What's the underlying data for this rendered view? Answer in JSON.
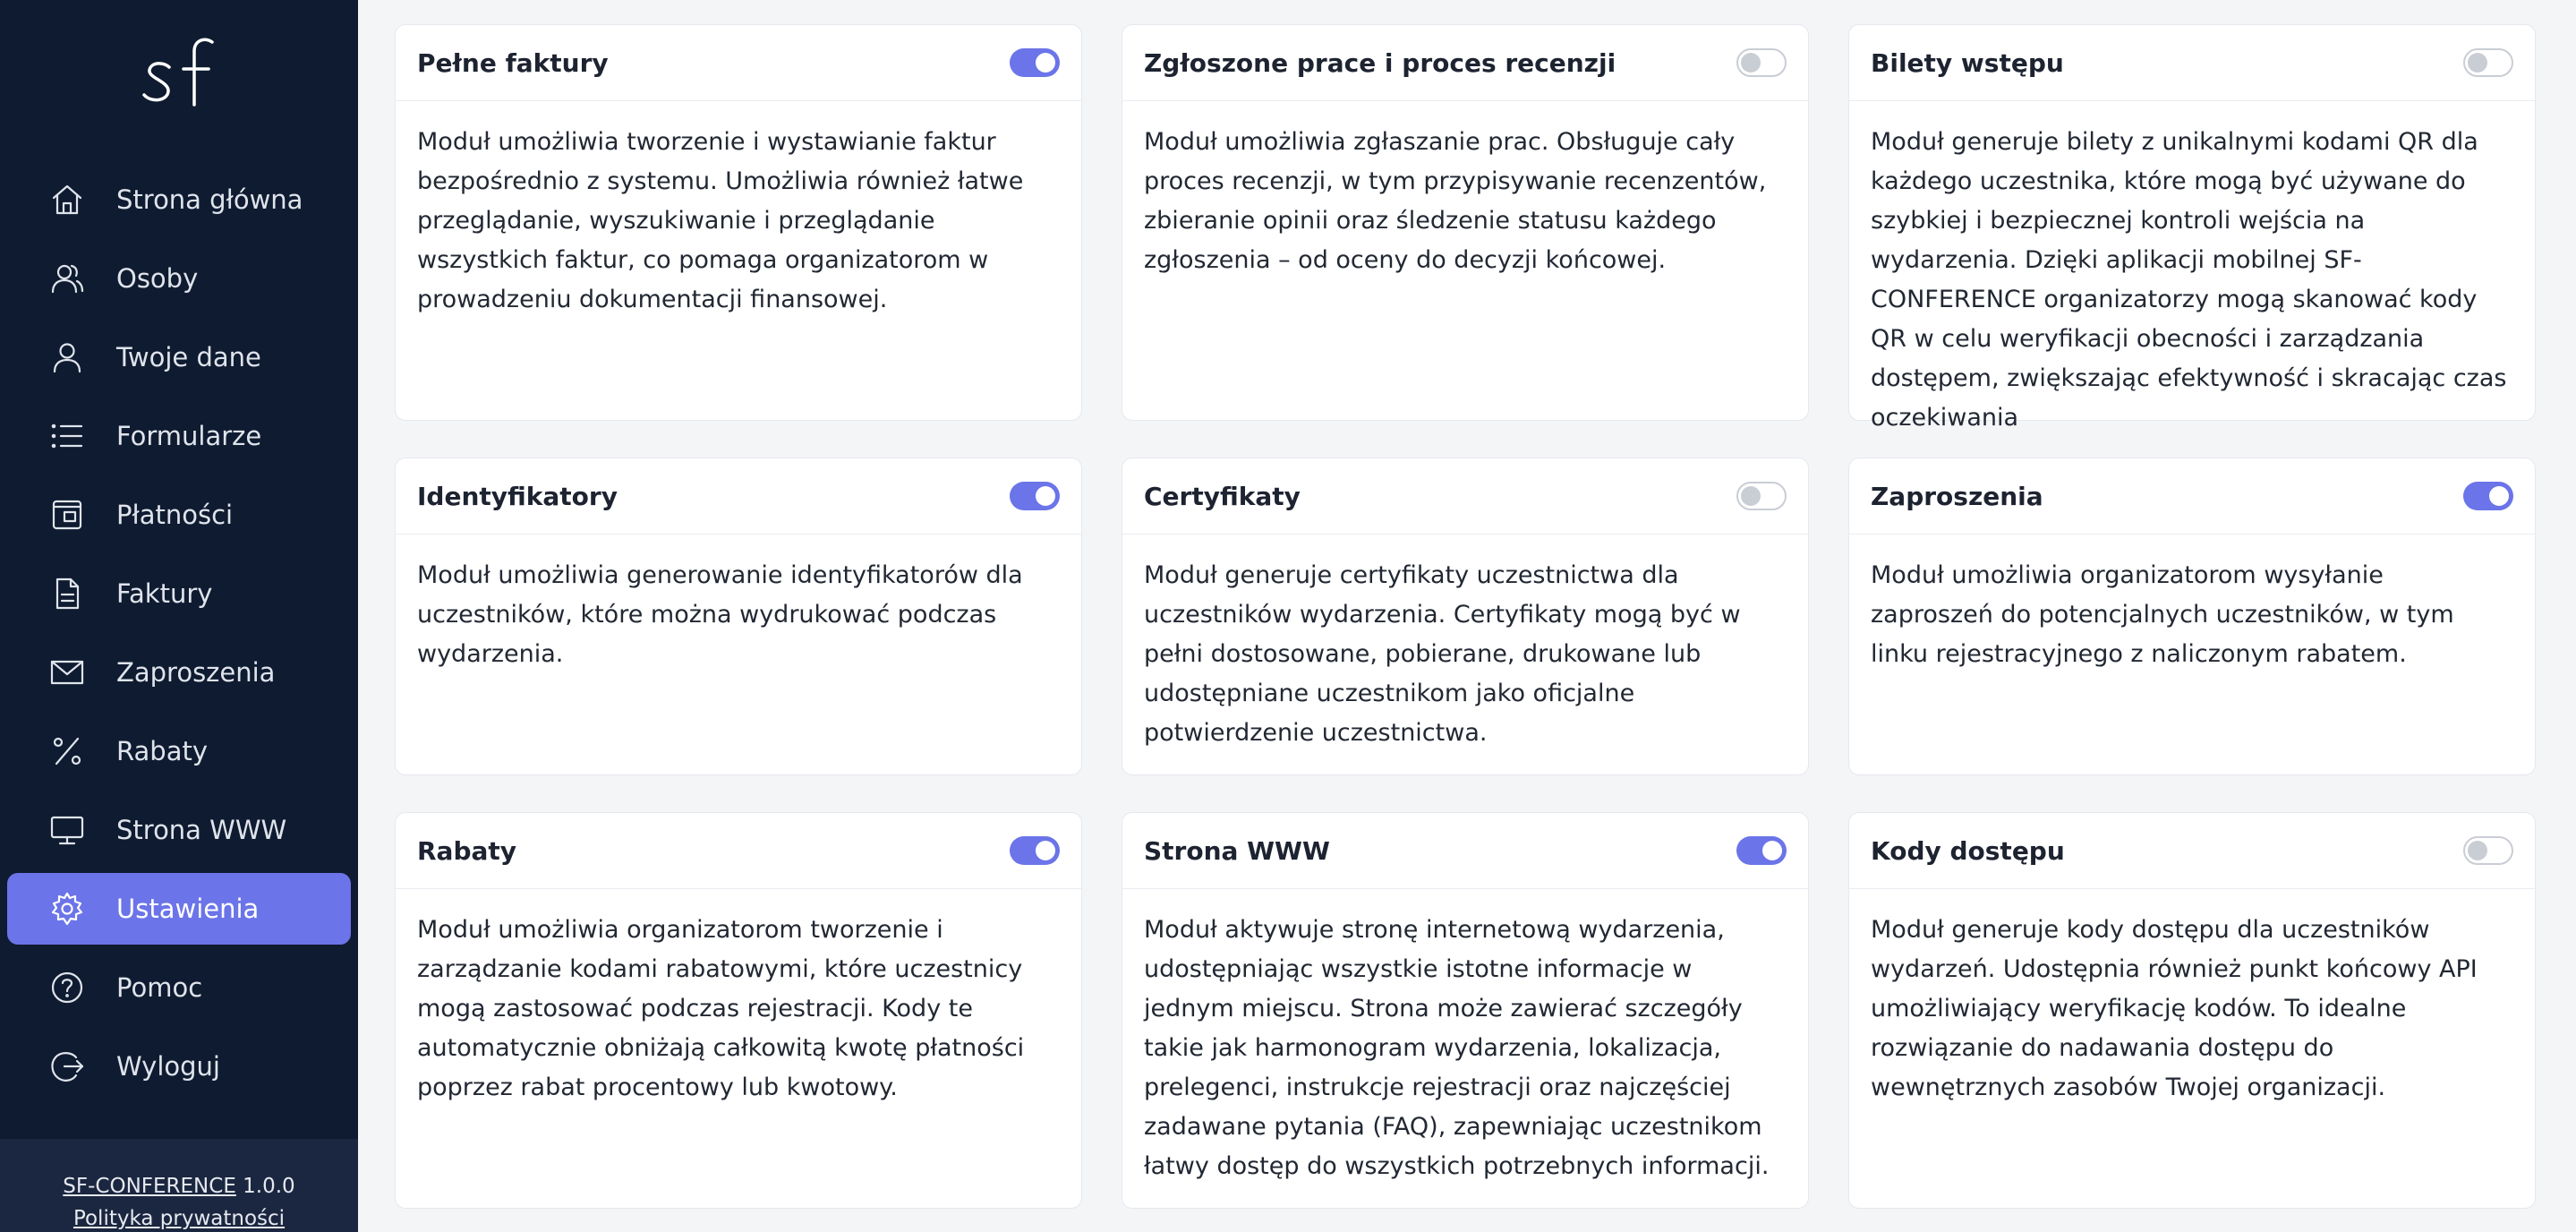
{
  "sidebar": {
    "logo_text": "sf",
    "items": [
      {
        "label": "Strona główna",
        "icon": "home-icon"
      },
      {
        "label": "Osoby",
        "icon": "users-icon"
      },
      {
        "label": "Twoje dane",
        "icon": "user-icon"
      },
      {
        "label": "Formularze",
        "icon": "list-icon"
      },
      {
        "label": "Płatności",
        "icon": "wallet-icon"
      },
      {
        "label": "Faktury",
        "icon": "document-icon"
      },
      {
        "label": "Zaproszenia",
        "icon": "mail-icon"
      },
      {
        "label": "Rabaty",
        "icon": "percent-icon"
      },
      {
        "label": "Strona WWW",
        "icon": "monitor-icon"
      },
      {
        "label": "Ustawienia",
        "icon": "gear-icon",
        "active": true
      },
      {
        "label": "Pomoc",
        "icon": "help-icon"
      },
      {
        "label": "Wyloguj",
        "icon": "logout-icon"
      }
    ],
    "footer": {
      "brand": "SF-CONFERENCE",
      "version": "1.0.0",
      "privacy": "Polityka prywatności"
    }
  },
  "colors": {
    "sidebar_bg": "#0f1b30",
    "accent": "#6b74e8",
    "toggle_off": "#c9cdd4"
  },
  "modules": [
    {
      "title": "Pełne faktury",
      "enabled": true,
      "description": "Moduł umożliwia tworzenie i wystawianie faktur bezpośrednio z systemu. Umożliwia również łatwe przeglądanie, wyszukiwanie i przeglądanie wszystkich faktur, co pomaga organizatorom w prowadzeniu dokumentacji finansowej."
    },
    {
      "title": "Zgłoszone prace i proces recenzji",
      "enabled": false,
      "description": "Moduł umożliwia zgłaszanie prac. Obsługuje cały proces recenzji, w tym przypisywanie recenzentów, zbieranie opinii oraz śledzenie statusu każdego zgłoszenia – od oceny do decyzji końcowej."
    },
    {
      "title": "Bilety wstępu",
      "enabled": false,
      "description": "Moduł generuje bilety z unikalnymi kodami QR dla każdego uczestnika, które mogą być używane do szybkiej i bezpiecznej kontroli wejścia na wydarzenia. Dzięki aplikacji mobilnej SF-CONFERENCE organizatorzy mogą skanować kody QR w celu weryfikacji obecności i zarządzania dostępem, zwiększając efektywność i skracając czas oczekiwania"
    },
    {
      "title": "Identyfikatory",
      "enabled": true,
      "description": "Moduł umożliwia generowanie identyfikatorów dla uczestników, które można wydrukować podczas wydarzenia."
    },
    {
      "title": "Certyfikaty",
      "enabled": false,
      "description": "Moduł generuje certyfikaty uczestnictwa dla uczestników wydarzenia. Certyfikaty mogą być w pełni dostosowane, pobierane, drukowane lub udostępniane uczestnikom jako oficjalne potwierdzenie uczestnictwa."
    },
    {
      "title": "Zaproszenia",
      "enabled": true,
      "description": "Moduł umożliwia organizatorom wysyłanie zaproszeń do potencjalnych uczestników, w tym linku rejestracyjnego z naliczonym rabatem."
    },
    {
      "title": "Rabaty",
      "enabled": true,
      "description": "Moduł umożliwia organizatorom tworzenie i zarządzanie kodami rabatowymi, które uczestnicy mogą zastosować podczas rejestracji. Kody te automatycznie obniżają całkowitą kwotę płatności poprzez rabat procentowy lub kwotowy."
    },
    {
      "title": "Strona WWW",
      "enabled": true,
      "description": "Moduł aktywuje stronę internetową wydarzenia, udostępniając wszystkie istotne informacje w jednym miejscu. Strona może zawierać szczegóły takie jak harmonogram wydarzenia, lokalizacja, prelegenci, instrukcje rejestracji oraz najczęściej zadawane pytania (FAQ), zapewniając uczestnikom łatwy dostęp do wszystkich potrzebnych informacji."
    },
    {
      "title": "Kody dostępu",
      "enabled": false,
      "description": "Moduł generuje kody dostępu dla uczestników wydarzeń. Udostępnia również punkt końcowy API umożliwiający weryfikację kodów. To idealne rozwiązanie do nadawania dostępu do wewnętrznych zasobów Twojej organizacji."
    }
  ]
}
